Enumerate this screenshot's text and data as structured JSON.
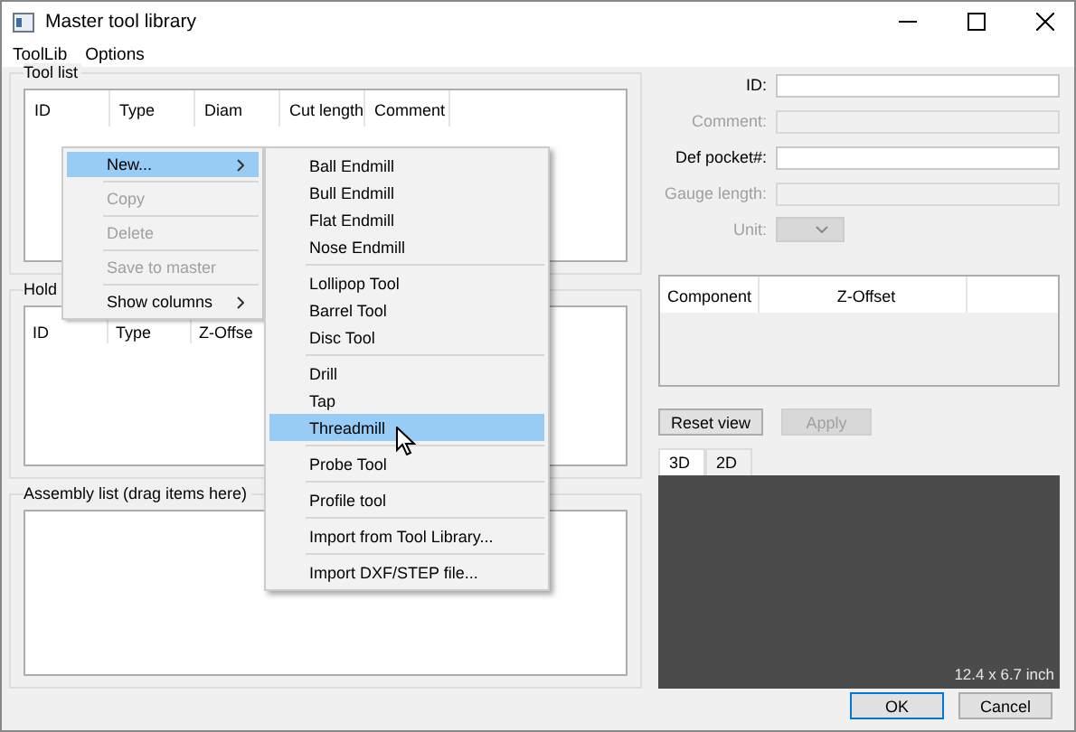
{
  "window": {
    "title": "Master tool library"
  },
  "menu_bar": [
    {
      "label": "ToolLib"
    },
    {
      "label": "Options"
    }
  ],
  "tool_list": {
    "title": "Tool list",
    "columns": [
      "ID",
      "Type",
      "Diam",
      "Cut length",
      "Comment"
    ]
  },
  "holder_list": {
    "title": "Hold",
    "columns": [
      "ID",
      "Type",
      "Z-Offse"
    ]
  },
  "assembly_list": {
    "title": "Assembly list (drag items here)"
  },
  "context_menu": {
    "items": [
      {
        "label": "New...",
        "submenu": true,
        "disabled": false,
        "selected": true
      },
      {
        "label": "Copy",
        "submenu": false,
        "disabled": true,
        "selected": false
      },
      {
        "label": "Delete",
        "submenu": false,
        "disabled": true,
        "selected": false
      },
      {
        "label": "Save to master",
        "submenu": false,
        "disabled": true,
        "selected": false
      },
      {
        "label": "Show columns",
        "submenu": true,
        "disabled": false,
        "selected": false
      }
    ]
  },
  "submenu": {
    "groups": [
      [
        {
          "label": "Ball Endmill",
          "selected": false
        },
        {
          "label": "Bull Endmill",
          "selected": false
        },
        {
          "label": "Flat Endmill",
          "selected": false
        },
        {
          "label": "Nose Endmill",
          "selected": false
        }
      ],
      [
        {
          "label": "Lollipop Tool",
          "selected": false
        },
        {
          "label": "Barrel Tool",
          "selected": false
        },
        {
          "label": "Disc Tool",
          "selected": false
        }
      ],
      [
        {
          "label": "Drill",
          "selected": false
        },
        {
          "label": "Tap",
          "selected": false
        },
        {
          "label": "Threadmill",
          "selected": true
        }
      ],
      [
        {
          "label": "Probe Tool",
          "selected": false
        }
      ],
      [
        {
          "label": "Profile tool",
          "selected": false
        }
      ],
      [
        {
          "label": "Import from Tool Library...",
          "selected": false
        }
      ],
      [
        {
          "label": "Import DXF/STEP file...",
          "selected": false
        }
      ]
    ]
  },
  "properties": {
    "fields": [
      {
        "label": "ID:",
        "kind": "text",
        "disabled": false
      },
      {
        "label": "Comment:",
        "kind": "text",
        "disabled": true
      },
      {
        "label": "Def pocket#:",
        "kind": "text",
        "disabled": false
      },
      {
        "label": "Gauge length:",
        "kind": "text",
        "disabled": true
      },
      {
        "label": "Unit:",
        "kind": "combo",
        "disabled": true
      }
    ]
  },
  "components_table": {
    "columns": [
      "Component",
      "Z-Offset"
    ]
  },
  "view_buttons": [
    {
      "label": "Reset view",
      "disabled": false
    },
    {
      "label": "Apply",
      "disabled": true
    }
  ],
  "view_tabs": [
    {
      "label": "3D",
      "selected": true
    },
    {
      "label": "2D",
      "selected": false
    }
  ],
  "viewport": {
    "dimensions": "12.4 x 6.7 inch"
  },
  "dialog_buttons": [
    {
      "label": "OK",
      "default": true
    },
    {
      "label": "Cancel",
      "default": false
    }
  ]
}
